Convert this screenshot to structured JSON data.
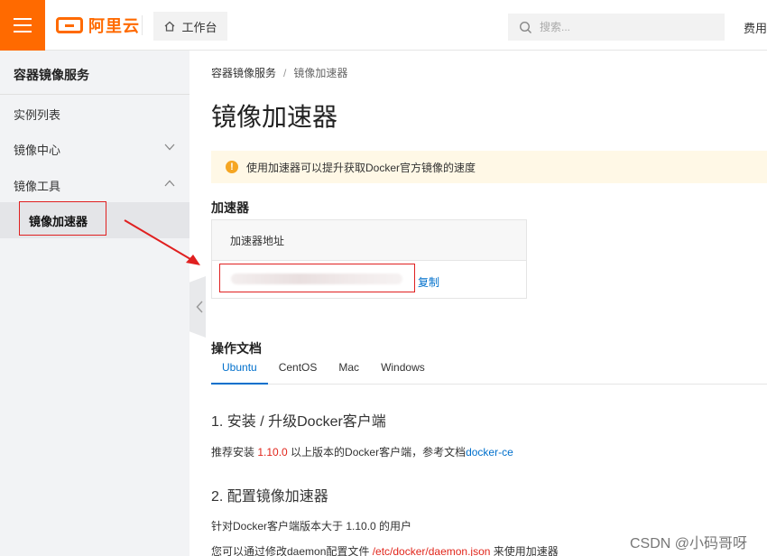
{
  "topbar": {
    "logo_text": "阿里云",
    "workbench_label": "工作台",
    "search_placeholder": "搜索...",
    "fee_label": "费用"
  },
  "sidebar": {
    "title": "容器镜像服务",
    "items": [
      {
        "label": "实例列表"
      },
      {
        "label": "镜像中心"
      },
      {
        "label": "镜像工具"
      },
      {
        "label": "镜像加速器"
      }
    ]
  },
  "main": {
    "breadcrumb": [
      "容器镜像服务",
      "镜像加速器"
    ],
    "breadcrumb_sep": "/",
    "title": "镜像加速器",
    "notice": "使用加速器可以提升获取Docker官方镜像的速度",
    "accelerator": {
      "heading": "加速器",
      "column_header": "加速器地址",
      "copy_label": "复制"
    },
    "docs": {
      "heading": "操作文档",
      "tabs": [
        "Ubuntu",
        "CentOS",
        "Mac",
        "Windows"
      ],
      "step1_title": "1. 安装 / 升级Docker客户端",
      "step1_pre": "推荐安装 ",
      "step1_version": "1.10.0",
      "step1_mid": " 以上版本的Docker客户端，参考文档",
      "step1_link": "docker-ce",
      "step2_title": "2. 配置镜像加速器",
      "step2_line1": "针对Docker客户端版本大于 1.10.0 的用户",
      "step2_line2_pre": "您可以通过修改daemon配置文件 ",
      "step2_line2_path": "/etc/docker/daemon.json",
      "step2_line2_post": " 来使用加速器"
    }
  },
  "watermark": "CSDN @小码哥呀",
  "colors": {
    "brand": "#ff6a00",
    "link": "#0070cc",
    "annotation": "#e02020",
    "notice_bg": "#fff8e6",
    "sidebar_bg": "#f2f3f5"
  }
}
